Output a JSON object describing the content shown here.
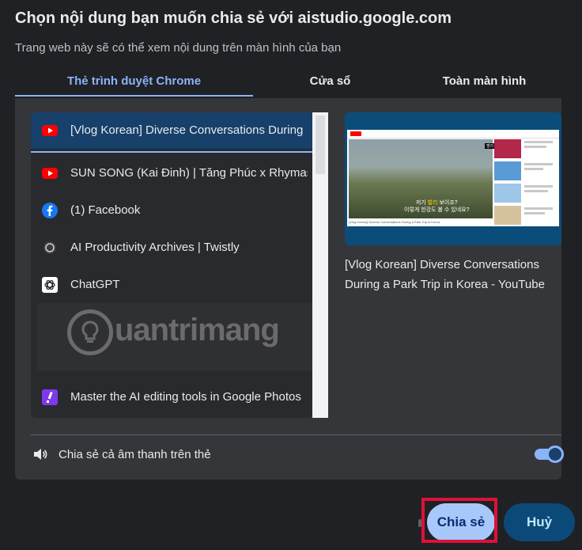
{
  "dialog": {
    "title": "Chọn nội dung bạn muốn chia sẻ với aistudio.google.com",
    "subtitle": "Trang web này sẽ có thể xem nội dung trên màn hình của bạn"
  },
  "tabs": [
    {
      "label": "Thẻ trình duyệt Chrome",
      "active": true
    },
    {
      "label": "Cửa sổ",
      "active": false
    },
    {
      "label": "Toàn màn hình",
      "active": false
    }
  ],
  "tab_list": [
    {
      "title": "[Vlog Korean] Diverse Conversations During",
      "icon": "youtube-icon",
      "selected": true
    },
    {
      "title": "SUN SONG (Kai Đinh) | Tăng Phúc x Rhymast",
      "icon": "youtube-icon",
      "selected": false
    },
    {
      "title": "(1) Facebook",
      "icon": "facebook-icon",
      "selected": false
    },
    {
      "title": "AI Productivity Archives | Twistly",
      "icon": "twistly-icon",
      "selected": false
    },
    {
      "title": "ChatGPT",
      "icon": "chatgpt-icon",
      "selected": false
    },
    {
      "title": "Master the AI editing tools in Google Photos",
      "icon": "google-photos-slash-icon",
      "selected": false
    }
  ],
  "watermark": {
    "text": "uantrimang"
  },
  "preview": {
    "title": "[Vlog Korean] Diverse Conversations During a Park Trip in Korea - YouTube",
    "caption_line1_pre": "저기 ",
    "caption_line1_hl": "벌리",
    "caption_line1_post": " 보이죠?",
    "caption_line2": "이렇게 한강도 볼 수 있네요?",
    "bottom_text": "[Vlog Korean] Diverse Conversations During a Park Trip in Korea",
    "chrome_tag": "멜리 지에이"
  },
  "audio": {
    "label": "Chia sẻ cả âm thanh trên thẻ",
    "enabled": true
  },
  "buttons": {
    "share": "Chia sẻ",
    "cancel": "Huỷ"
  },
  "colors": {
    "accent": "#8ab4f8",
    "selected_row": "#17406b",
    "share_btn": "#a8c7fa",
    "cancel_btn": "#0b4a78",
    "highlight": "#e0103a"
  }
}
